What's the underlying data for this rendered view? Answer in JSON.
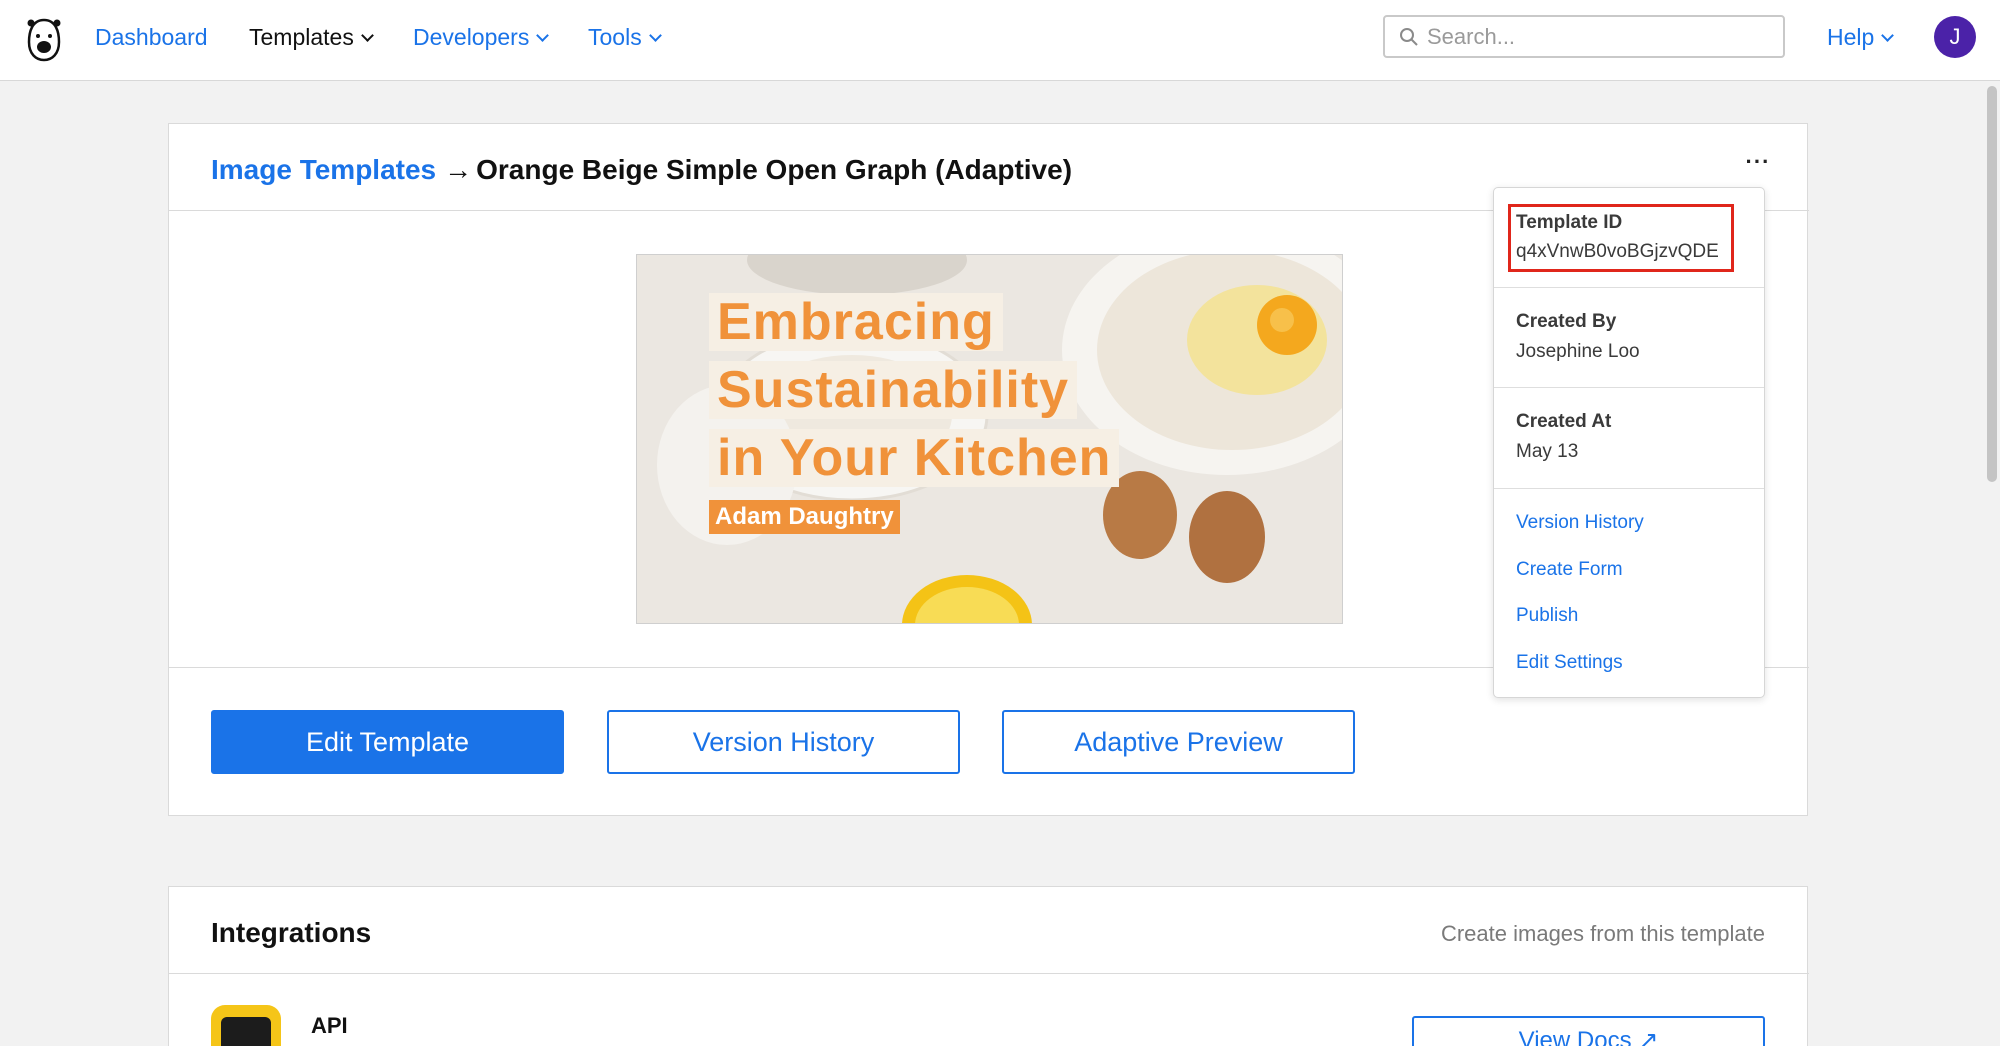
{
  "nav": {
    "logo_icon": "bear-logo-icon",
    "links": [
      {
        "label": "Dashboard"
      },
      {
        "label": "Templates"
      },
      {
        "label": "Developers"
      },
      {
        "label": "Tools"
      }
    ],
    "search_placeholder": "Search...",
    "help_label": "Help",
    "avatar_initial": "J"
  },
  "header": {
    "breadcrumb_link": "Image Templates",
    "breadcrumb_arrow": "→",
    "title": "Orange Beige Simple Open Graph (Adaptive)",
    "more_label": "···"
  },
  "preview": {
    "lines": [
      "Embracing",
      "Sustainability",
      "in Your Kitchen"
    ],
    "author": "Adam Daughtry",
    "accent_color": "#f0923a",
    "text_bg_color": "#f6efe4"
  },
  "actions": {
    "edit_template": "Edit Template",
    "version_history": "Version History",
    "adaptive_preview": "Adaptive Preview"
  },
  "menu": {
    "template_id_label": "Template ID",
    "template_id_value": "q4xVnwB0voBGjzvQDE",
    "created_by_label": "Created By",
    "created_by_value": "Josephine Loo",
    "created_at_label": "Created At",
    "created_at_value": "May 13",
    "links": [
      "Version History",
      "Create Form",
      "Publish",
      "Edit Settings"
    ]
  },
  "integrations": {
    "title": "Integrations",
    "subtitle": "Create images from this template",
    "api_label": "API",
    "docs_label": "View Docs ↗"
  },
  "colors": {
    "brand_blue": "#1a73e8",
    "avatar": "#4b22a8",
    "highlight_red": "#e0261b"
  }
}
